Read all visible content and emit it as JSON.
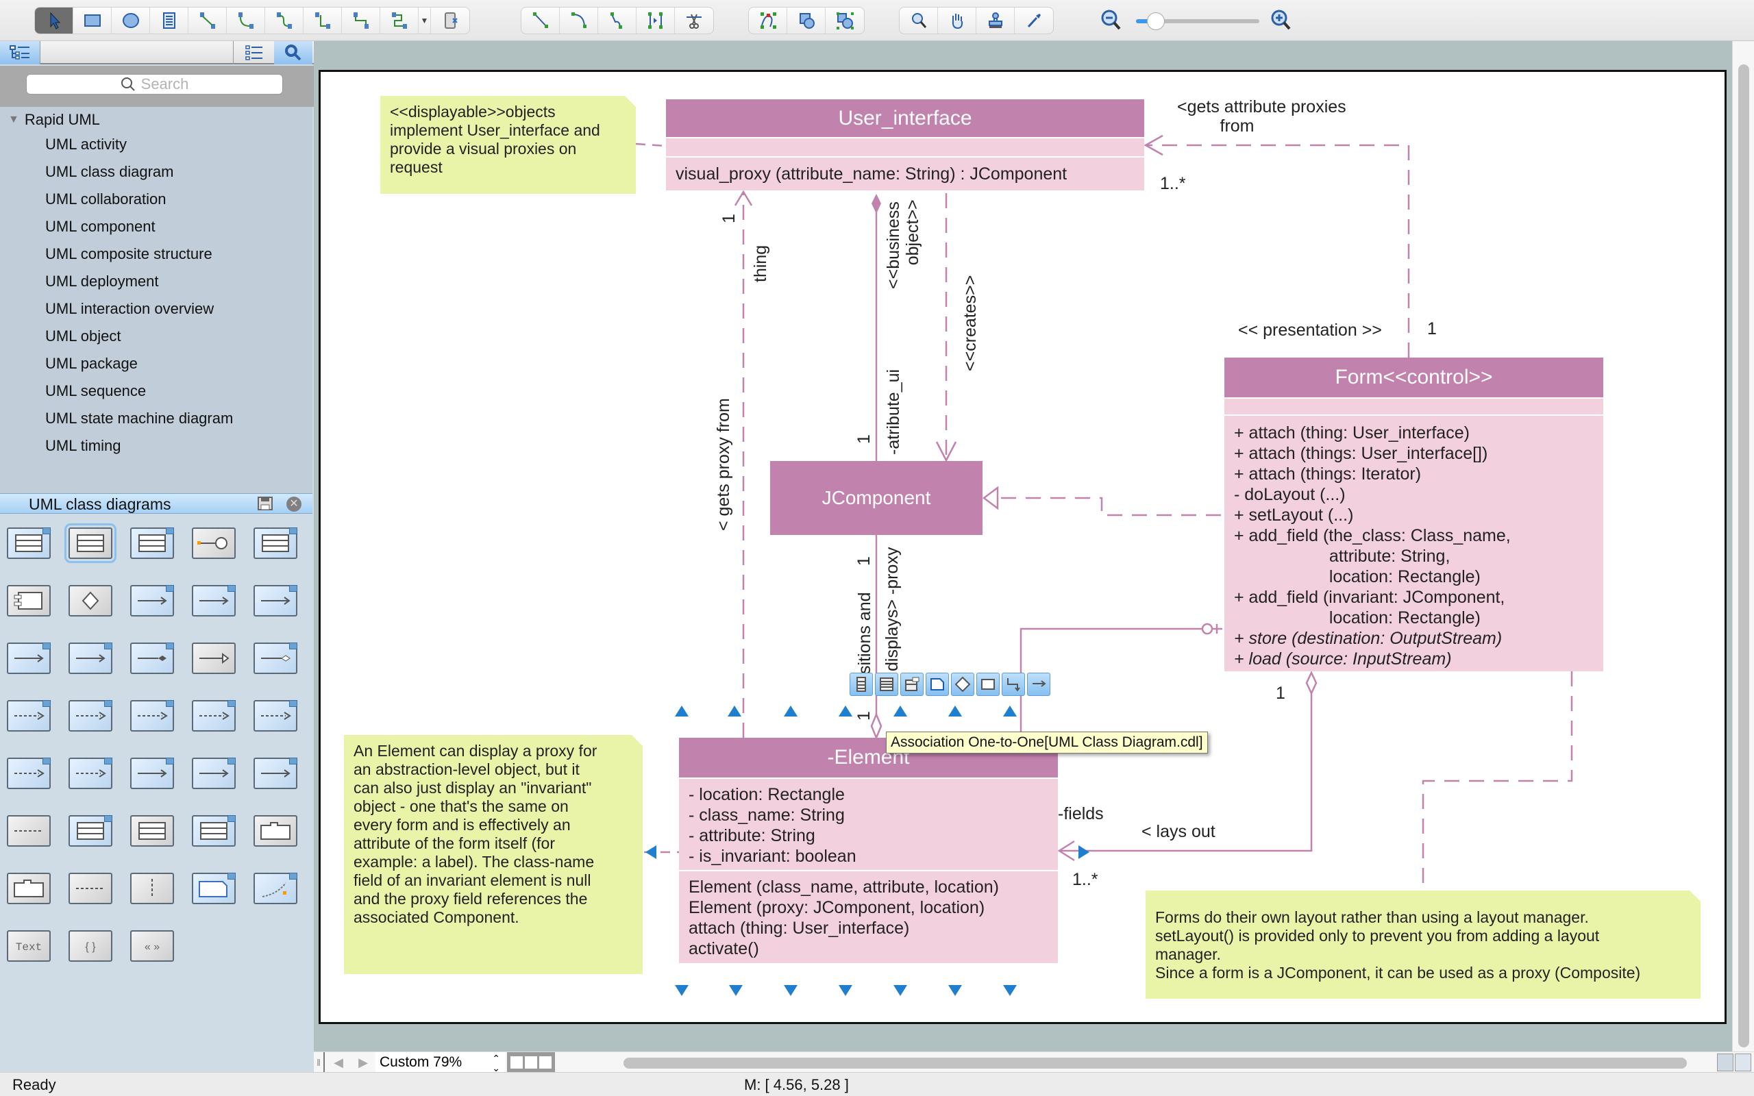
{
  "toolbar": {
    "groups": [
      {
        "name": "drawing",
        "tools": [
          "pointer-tool",
          "rectangle-tool",
          "ellipse-tool",
          "text-block-tool",
          "direct-connector-tool",
          "arc-connector-tool",
          "bezier-connector-tool",
          "orthogonal-connector-tool",
          "round-connector-tool",
          "smart-connector-tool",
          "more-connectors-dropdown",
          "insert-container-tool"
        ]
      },
      {
        "name": "lines",
        "tools": [
          "line-tool",
          "arc-tool",
          "curve-tool",
          "split-tool",
          "scissors-tool"
        ]
      },
      {
        "name": "shape-ops",
        "tools": [
          "freehand-tool",
          "union-tool",
          "group-tool"
        ]
      },
      {
        "name": "view",
        "tools": [
          "zoom-tool",
          "pan-tool",
          "stamp-tool",
          "eyedropper-tool"
        ]
      }
    ],
    "zoom_slider_value": 0.1
  },
  "sidebar": {
    "search_placeholder": "Search",
    "tree": {
      "root": "Rapid UML",
      "items": [
        "UML activity",
        "UML class diagram",
        "UML collaboration",
        "UML component",
        "UML composite structure",
        "UML deployment",
        "UML interaction overview",
        "UML object",
        "UML package",
        "UML sequence",
        "UML state machine diagram",
        "UML timing"
      ]
    },
    "library": {
      "title": "UML class diagrams",
      "shapes": [
        "class",
        "object",
        "class-name-only",
        "interface",
        "template-class",
        "component",
        "n-ary-association",
        "association",
        "directed-association",
        "multiplicity-association",
        "many-to-many-association",
        "one-to-one-association",
        "composition",
        "generalization",
        "aggregation",
        "realization",
        "dependency",
        "interface-realization",
        "composition-dependency",
        "orthogonal-composition-dependency",
        "composition-dependency-2",
        "orthogonal-dependency",
        "reverse-composition",
        "orthogonal-reverse",
        "one-to-many-association",
        "separator",
        "class-two-sections",
        "note-box",
        "stacked-object",
        "package",
        "package-2",
        "horizontal-separator",
        "vertical-separator",
        "comment",
        "constraint-link",
        "text",
        "constraint",
        "stereotype"
      ],
      "text_shape_label": "Text",
      "constraint_label": "{ }",
      "stereotype_label": "«  »"
    }
  },
  "diagram": {
    "notes": {
      "displayable": "<<displayable>>objects\nimplement User_interface and\nprovide a visual proxies on\nrequest",
      "element": "An Element can display a proxy for\nan abstraction-level object, but it\ncan also just display an \"invariant\"\nobject - one that's the same on\nevery form and is effectively an\nattribute of the form itself (for\nexample: a label). The class-name\nfield of an invariant element is null\nand the proxy field references the\nassociated Component.",
      "forms": "Forms do their own layout rather than using a layout manager.\nsetLayout() is provided only to prevent you from adding a layout\nmanager.\nSince a form is a JComponent, it can be used as a proxy (Composite)"
    },
    "classes": {
      "user_interface": {
        "name": "User_interface",
        "attributes": "",
        "operations": "visual_proxy (attribute_name: String) : JComponent"
      },
      "jcomponent": {
        "name": "JComponent"
      },
      "form": {
        "name": "Form<<control>>",
        "operations": [
          "+ attach (thing: User_interface)",
          "+ attach (things: User_interface[])",
          "+ attach (things: Iterator)",
          "- doLayout (...)",
          "+ setLayout (...)",
          "+ add_field (the_class: Class_name,",
          "                    attribute: String,",
          "                    location: Rectangle)",
          "+ add_field (invariant: JComponent,",
          "                    location: Rectangle)",
          "+ store (destination: OutputStream)",
          "+ load (source: InputStream)"
        ]
      },
      "element": {
        "name": "-Element",
        "attributes": [
          "- location: Rectangle",
          "- class_name: String",
          "- attribute: String",
          "- is_invariant: boolean"
        ],
        "operations": [
          "Element (class_name, attribute, location)",
          "Element (proxy: JComponent, location)",
          "attach (thing: User_interface)",
          "activate()"
        ]
      }
    },
    "labels": {
      "gets_attribute_proxies": "<gets attribute proxies\n         from",
      "mult_1_many_top": "1..*",
      "presentation": "<< presentation >>",
      "mult_1_form_top": "1",
      "thing": "thing",
      "mult_1_thing": "1",
      "business_object": "<<business\n     object>>",
      "creates": "<<creates>>",
      "gets_proxy_from": "< gets proxy from",
      "atribute_ui": "-atribute_ui",
      "mult_1_atribute": "1",
      "positions_and": "sitions and",
      "displays_proxy": "displays> -proxy",
      "mult_1_proxy": "1",
      "mult_1_element": "1",
      "fields": "-fields",
      "lays_out": "< lays out",
      "mult_1_many_fields": "1..*",
      "mult_1_form_bottom": "1"
    },
    "tooltip": "Association One-to-One[UML Class Diagram.cdl]",
    "context_buttons": [
      "class-shape",
      "class-sections",
      "template-class",
      "note",
      "n-ary-diamond",
      "object-box",
      "orthogonal-dependency",
      "dependency-arrow"
    ]
  },
  "colors": {
    "class_header": "#c182ae",
    "class_body": "#f3d0dd",
    "note": "#eaf4a8",
    "connector": "#c182ae",
    "canvas_bg": "#b1c0c0",
    "selection_handle": "#1f7fcf"
  },
  "bottom": {
    "zoom_label": "Custom 79%",
    "status": "Ready",
    "mouse_position": "M: [ 4.56, 5.28 ]"
  }
}
